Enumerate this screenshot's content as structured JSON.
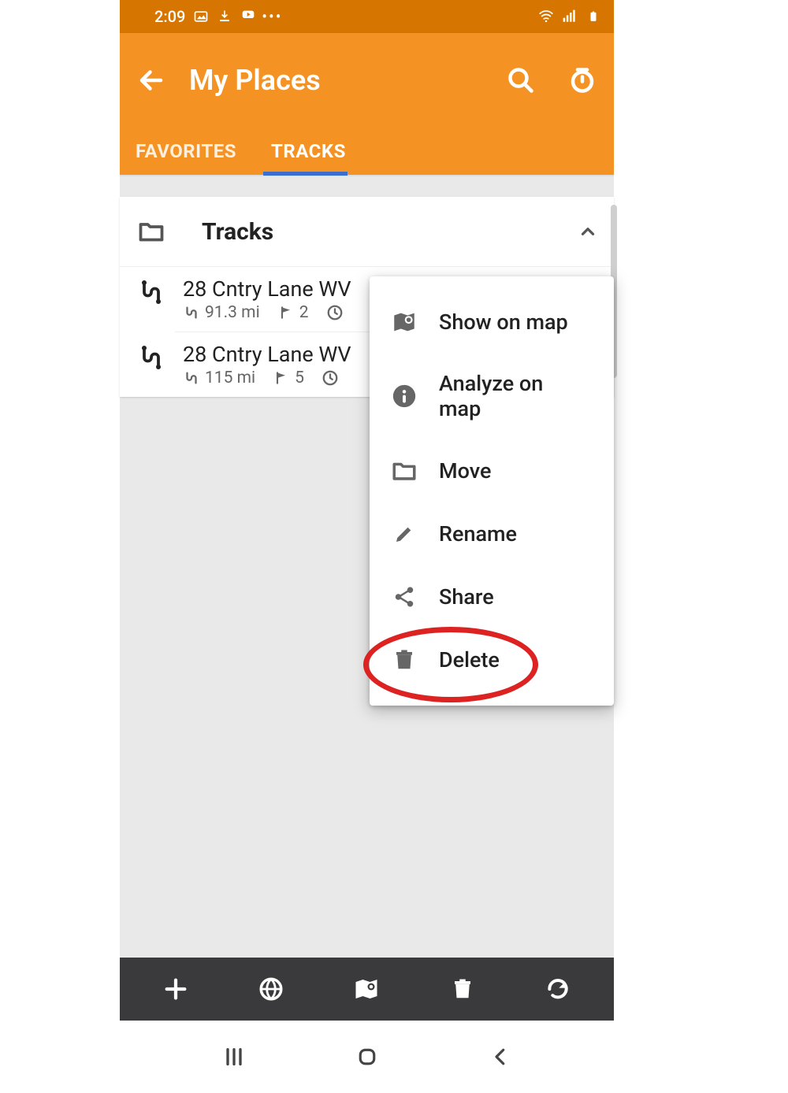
{
  "status": {
    "time": "2:09",
    "icons": [
      "image-icon",
      "download-icon",
      "play-icon",
      "more-icon"
    ],
    "right_icons": [
      "wifi-icon",
      "signal-icon",
      "battery-icon"
    ]
  },
  "appbar": {
    "title": "My Places",
    "tabs": [
      {
        "label": "FAVORITES",
        "active": false
      },
      {
        "label": "TRACKS",
        "active": true
      }
    ]
  },
  "folder": {
    "title": "Tracks"
  },
  "tracks": [
    {
      "title": "28 Cntry Lane WV",
      "distance": "91.3 mi",
      "waypoints": "2"
    },
    {
      "title": "28 Cntry Lane WV",
      "distance": "115 mi",
      "waypoints": "5"
    }
  ],
  "menu": {
    "items": [
      {
        "icon": "map-pin-icon",
        "label": "Show on map"
      },
      {
        "icon": "info-icon",
        "label": "Analyze on map"
      },
      {
        "icon": "folder-icon",
        "label": "Move"
      },
      {
        "icon": "pencil-icon",
        "label": "Rename"
      },
      {
        "icon": "share-icon",
        "label": "Share"
      },
      {
        "icon": "trash-icon",
        "label": "Delete"
      }
    ]
  },
  "bottombar": {
    "icons": [
      "plus-icon",
      "globe-icon",
      "map-icon",
      "trash-icon",
      "refresh-icon"
    ]
  }
}
